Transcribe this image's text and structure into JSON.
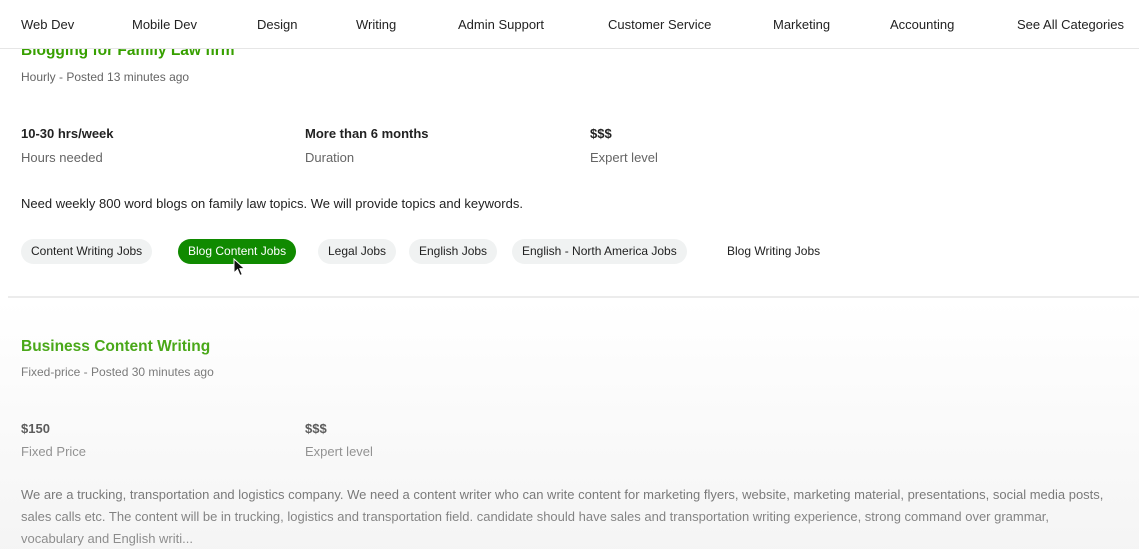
{
  "nav": {
    "items": [
      "Web Dev",
      "Mobile Dev",
      "Design",
      "Writing",
      "Admin Support",
      "Customer Service",
      "Marketing",
      "Accounting",
      "See All Categories"
    ]
  },
  "job1": {
    "title": "Blogging for Family Law firm",
    "meta": "Hourly - Posted 13 minutes ago",
    "hours_value": "10-30 hrs/week",
    "hours_label": "Hours needed",
    "duration_value": "More than 6 months",
    "duration_label": "Duration",
    "level_value": "$$$",
    "level_label": "Expert level",
    "description": "Need weekly 800 word blogs on family law topics. We will provide topics and keywords.",
    "tags": [
      "Content Writing Jobs",
      "Blog Content Jobs",
      "Legal Jobs",
      "English Jobs",
      "English - North America Jobs",
      "Blog Writing Jobs"
    ]
  },
  "job2": {
    "title": "Business Content Writing",
    "meta": "Fixed-price - Posted 30 minutes ago",
    "price_value": "$150",
    "price_label": "Fixed Price",
    "level_value": "$$$",
    "level_label": "Expert level",
    "description": "We are a trucking, transportation and logistics company. We need a content writer who can write content for marketing flyers, website, marketing material, presentations, social media posts, sales calls etc. The content will be in trucking, logistics and transportation field. candidate should have sales and transportation writing experience, strong command over grammar, vocabulary and English writi..."
  },
  "colors": {
    "accent_green": "#37a000",
    "active_tag": "#108a00"
  }
}
